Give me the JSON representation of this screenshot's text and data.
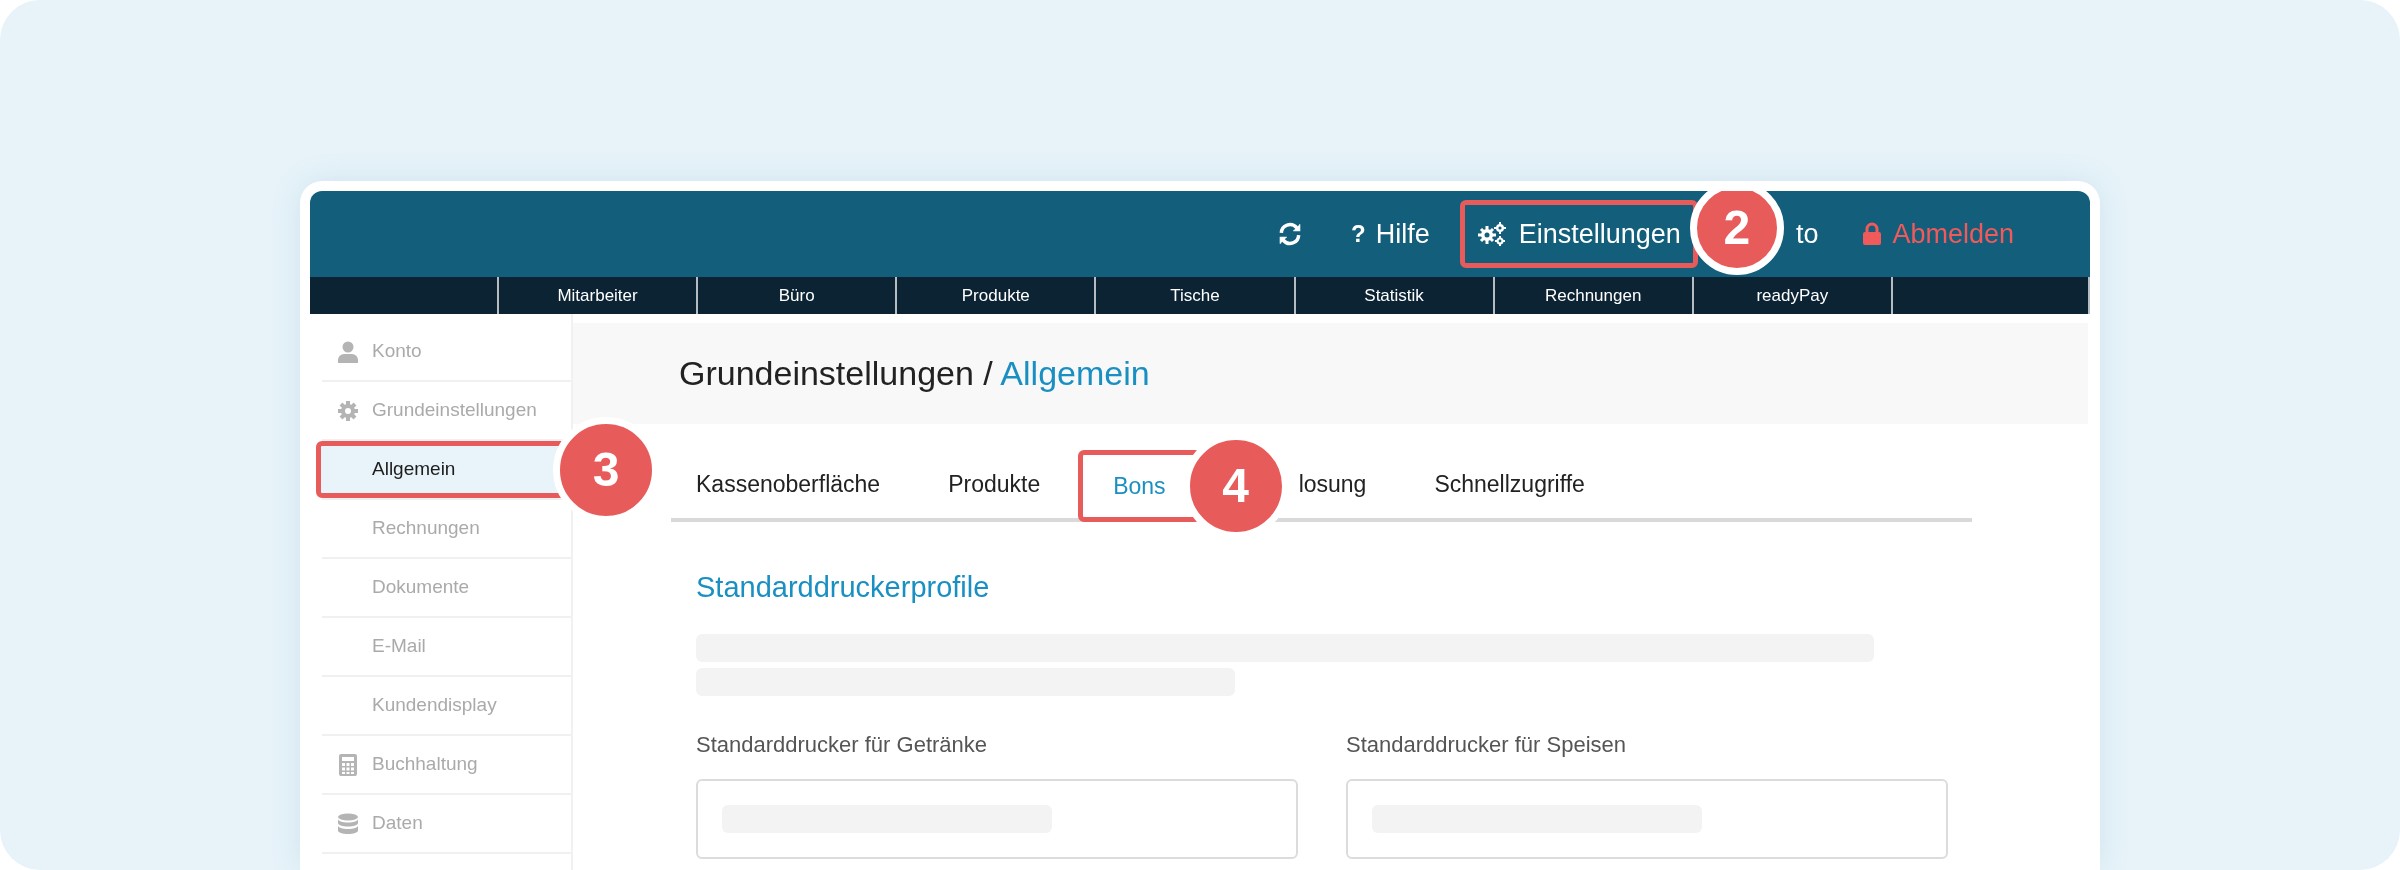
{
  "header": {
    "actions": [
      {
        "kind": "refresh"
      },
      {
        "kind": "help",
        "icon_text": "?",
        "label": "Hilfe"
      },
      {
        "kind": "settings",
        "label": "Einstellungen",
        "callout": "2"
      },
      {
        "kind": "text",
        "label": "to"
      },
      {
        "kind": "logout",
        "label": "Abmelden"
      }
    ]
  },
  "nav": [
    "Mitarbeiter",
    "Büro",
    "Produkte",
    "Tische",
    "Statistik",
    "Rechnungen",
    "readyPay"
  ],
  "sidebar": {
    "items": [
      {
        "label": "Konto",
        "selected": false
      },
      {
        "label": "Grundeinstellungen",
        "selected": false,
        "children": [
          {
            "label": "Allgemein",
            "selected": true,
            "callout": "3"
          },
          {
            "label": "Rechnungen",
            "selected": false
          },
          {
            "label": "Dokumente",
            "selected": false
          },
          {
            "label": "E-Mail",
            "selected": false
          },
          {
            "label": "Kundendisplay",
            "selected": false
          }
        ]
      },
      {
        "label": "Buchhaltung",
        "selected": false
      },
      {
        "label": "Daten",
        "selected": false
      }
    ]
  },
  "breadcrumb": {
    "parent": "Grundeinstellungen",
    "separator": "/",
    "current": "Allgemein"
  },
  "tabs": [
    {
      "label": "Kassenoberfläche",
      "selected": false
    },
    {
      "label": "Produkte",
      "selected": false
    },
    {
      "label": "Bons",
      "selected": true,
      "callout": "4"
    },
    {
      "label": "losung",
      "selected": false
    },
    {
      "label": "Schnellzugriffe",
      "selected": false
    }
  ],
  "section": {
    "title": "Standarddruckerprofile",
    "fields": [
      {
        "label": "Standarddrucker für Getränke"
      },
      {
        "label": "Standarddrucker für Speisen"
      }
    ]
  }
}
